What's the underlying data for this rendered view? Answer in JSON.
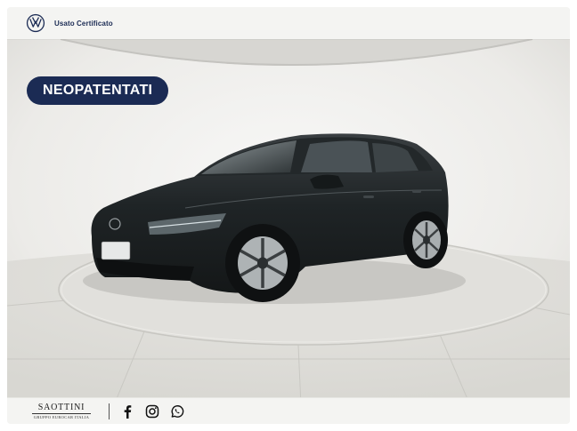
{
  "header": {
    "brand_label": "Usato Certificato",
    "logo_icon": "vw-logo-icon"
  },
  "badge": {
    "label": "NEOPATENTATI",
    "color": "#1b2b54"
  },
  "footer": {
    "dealer_name": "SAOTTINI",
    "dealer_subtitle": "GRUPPO EUROCAR ITALIA",
    "social": [
      {
        "icon": "facebook-icon"
      },
      {
        "icon": "instagram-icon"
      },
      {
        "icon": "whatsapp-icon"
      }
    ]
  },
  "colors": {
    "brand_navy": "#1b2b54",
    "car_body": "#1e2224",
    "backdrop": "#f0f0ee"
  }
}
